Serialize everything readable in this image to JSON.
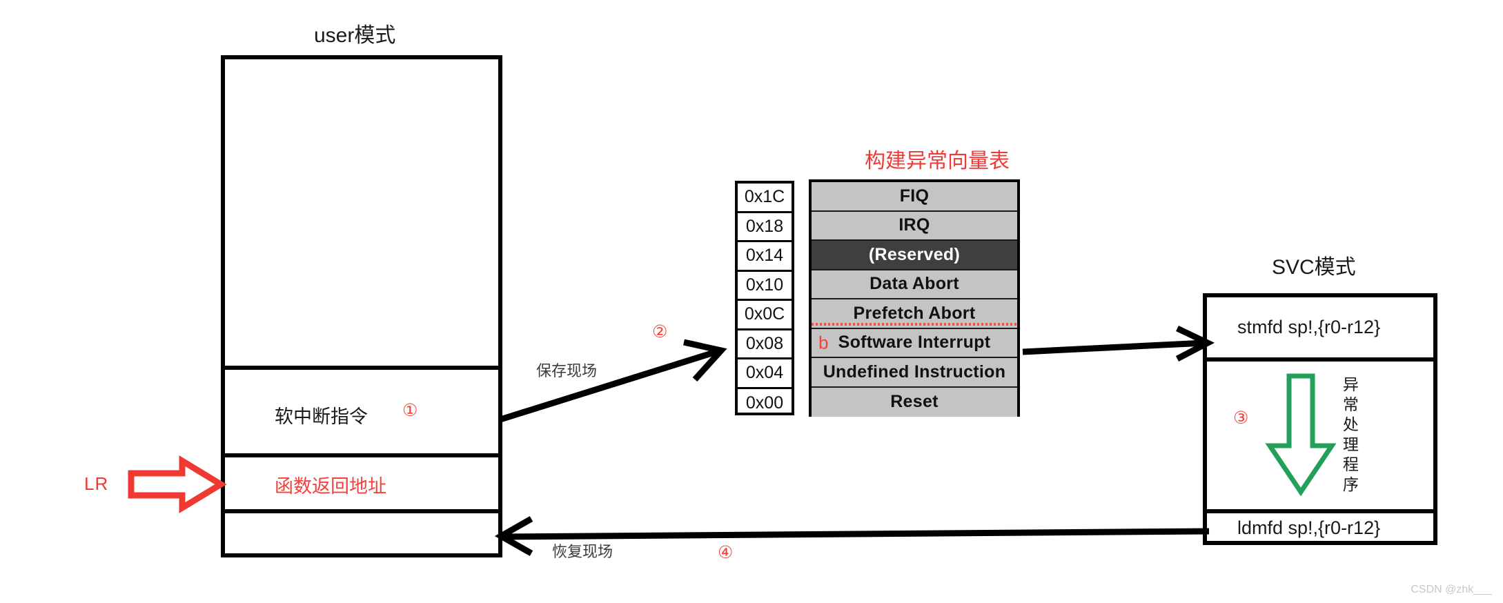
{
  "diagram": {
    "watermark": "CSDN @zhk___"
  },
  "user_mode": {
    "title": "user模式",
    "rows": [
      {
        "label": "",
        "color": "black"
      },
      {
        "label": "软中断指令",
        "color": "black"
      },
      {
        "label": "函数返回地址",
        "color": "red"
      },
      {
        "label": "",
        "color": "black"
      }
    ],
    "step_marker": "①",
    "lr_label": "LR",
    "lr_arrow_color": "#ee3a33"
  },
  "vector_table": {
    "title": "构建异常向量表",
    "title_color": "#ef3b35",
    "branch_marker": "b",
    "branch_marker_color": "#f4413b",
    "gray_fill": "#c4c4c4",
    "reserved_fill": "#3f3f3f",
    "addresses": [
      "0x1C",
      "0x18",
      "0x14",
      "0x10",
      "0x0C",
      "0x08",
      "0x04",
      "0x00"
    ],
    "entries": [
      {
        "name": "FIQ",
        "reserved": false,
        "marker": "",
        "squiggle": false
      },
      {
        "name": "IRQ",
        "reserved": false,
        "marker": "",
        "squiggle": false
      },
      {
        "name": "(Reserved)",
        "reserved": true,
        "marker": "",
        "squiggle": false
      },
      {
        "name": "Data Abort",
        "reserved": false,
        "marker": "",
        "squiggle": false
      },
      {
        "name": "Prefetch Abort",
        "reserved": false,
        "marker": "",
        "squiggle": true
      },
      {
        "name": "Software Interrupt",
        "reserved": false,
        "marker": "b",
        "squiggle": false
      },
      {
        "name": "Undefined Instruction",
        "reserved": false,
        "marker": "",
        "squiggle": false
      },
      {
        "name": "Reset",
        "reserved": false,
        "marker": "",
        "squiggle": false
      }
    ]
  },
  "svc_mode": {
    "title": "SVC模式",
    "push_instruction": "stmfd sp!,{r0-r12}",
    "pop_instruction": "ldmfd sp!,{r0-r12}",
    "handler_label": "异常处理程序",
    "step_marker": "③",
    "arrow_color": "#22a05a"
  },
  "flow": {
    "save_context": {
      "label": "保存现场",
      "step_marker": "②"
    },
    "restore_context": {
      "label": "恢复现场",
      "step_marker": "④"
    }
  }
}
